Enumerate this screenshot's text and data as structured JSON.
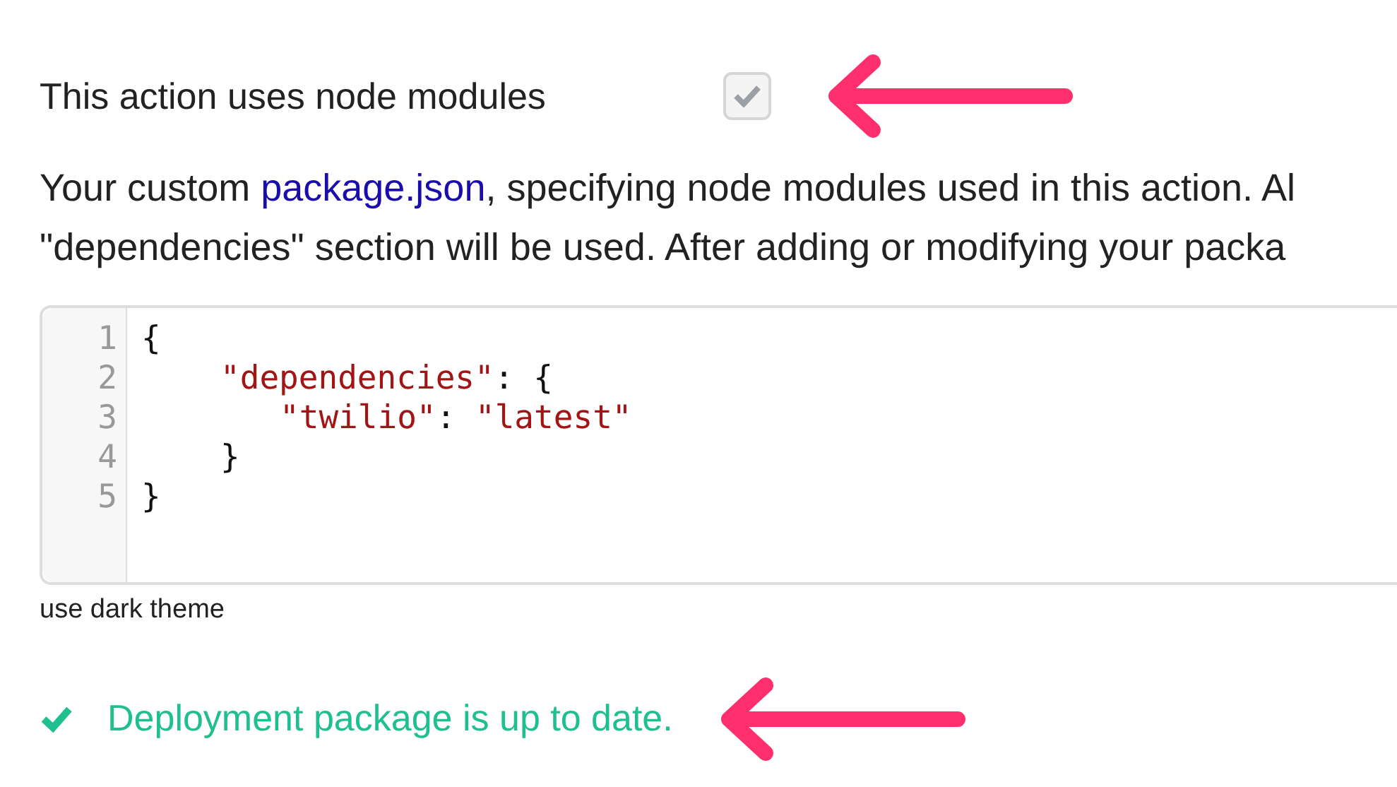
{
  "node_modules_option": {
    "label": "This action uses node modules",
    "checked": true,
    "disabled": true
  },
  "description": {
    "link_text": "package.json",
    "before_link": "Your custom ",
    "after_link": ", specifying node modules used in this action. Al",
    "line_2": "\"dependencies\" section will be used. After adding or modifying your packa"
  },
  "editor": {
    "lines": [
      {
        "number": "1",
        "kind": "outer",
        "tokens": [
          {
            "kind": "punct",
            "text": "{"
          }
        ]
      },
      {
        "number": "2",
        "kind": "inner",
        "tokens": [
          {
            "kind": "string",
            "text": "\"dependencies\""
          },
          {
            "kind": "punct",
            "text": ": {"
          }
        ]
      },
      {
        "number": "3",
        "kind": "innermost",
        "tokens": [
          {
            "kind": "string",
            "text": "\"twilio\""
          },
          {
            "kind": "punct",
            "text": ": "
          },
          {
            "kind": "string",
            "text": "\"latest\""
          }
        ]
      },
      {
        "number": "4",
        "kind": "inner",
        "tokens": [
          {
            "kind": "punct",
            "text": "}"
          }
        ]
      },
      {
        "number": "5",
        "kind": "outer",
        "tokens": [
          {
            "kind": "punct",
            "text": "}"
          }
        ]
      }
    ]
  },
  "theme_link": "use dark theme",
  "status": {
    "kind": "success",
    "message": "Deployment package is up to date."
  }
}
